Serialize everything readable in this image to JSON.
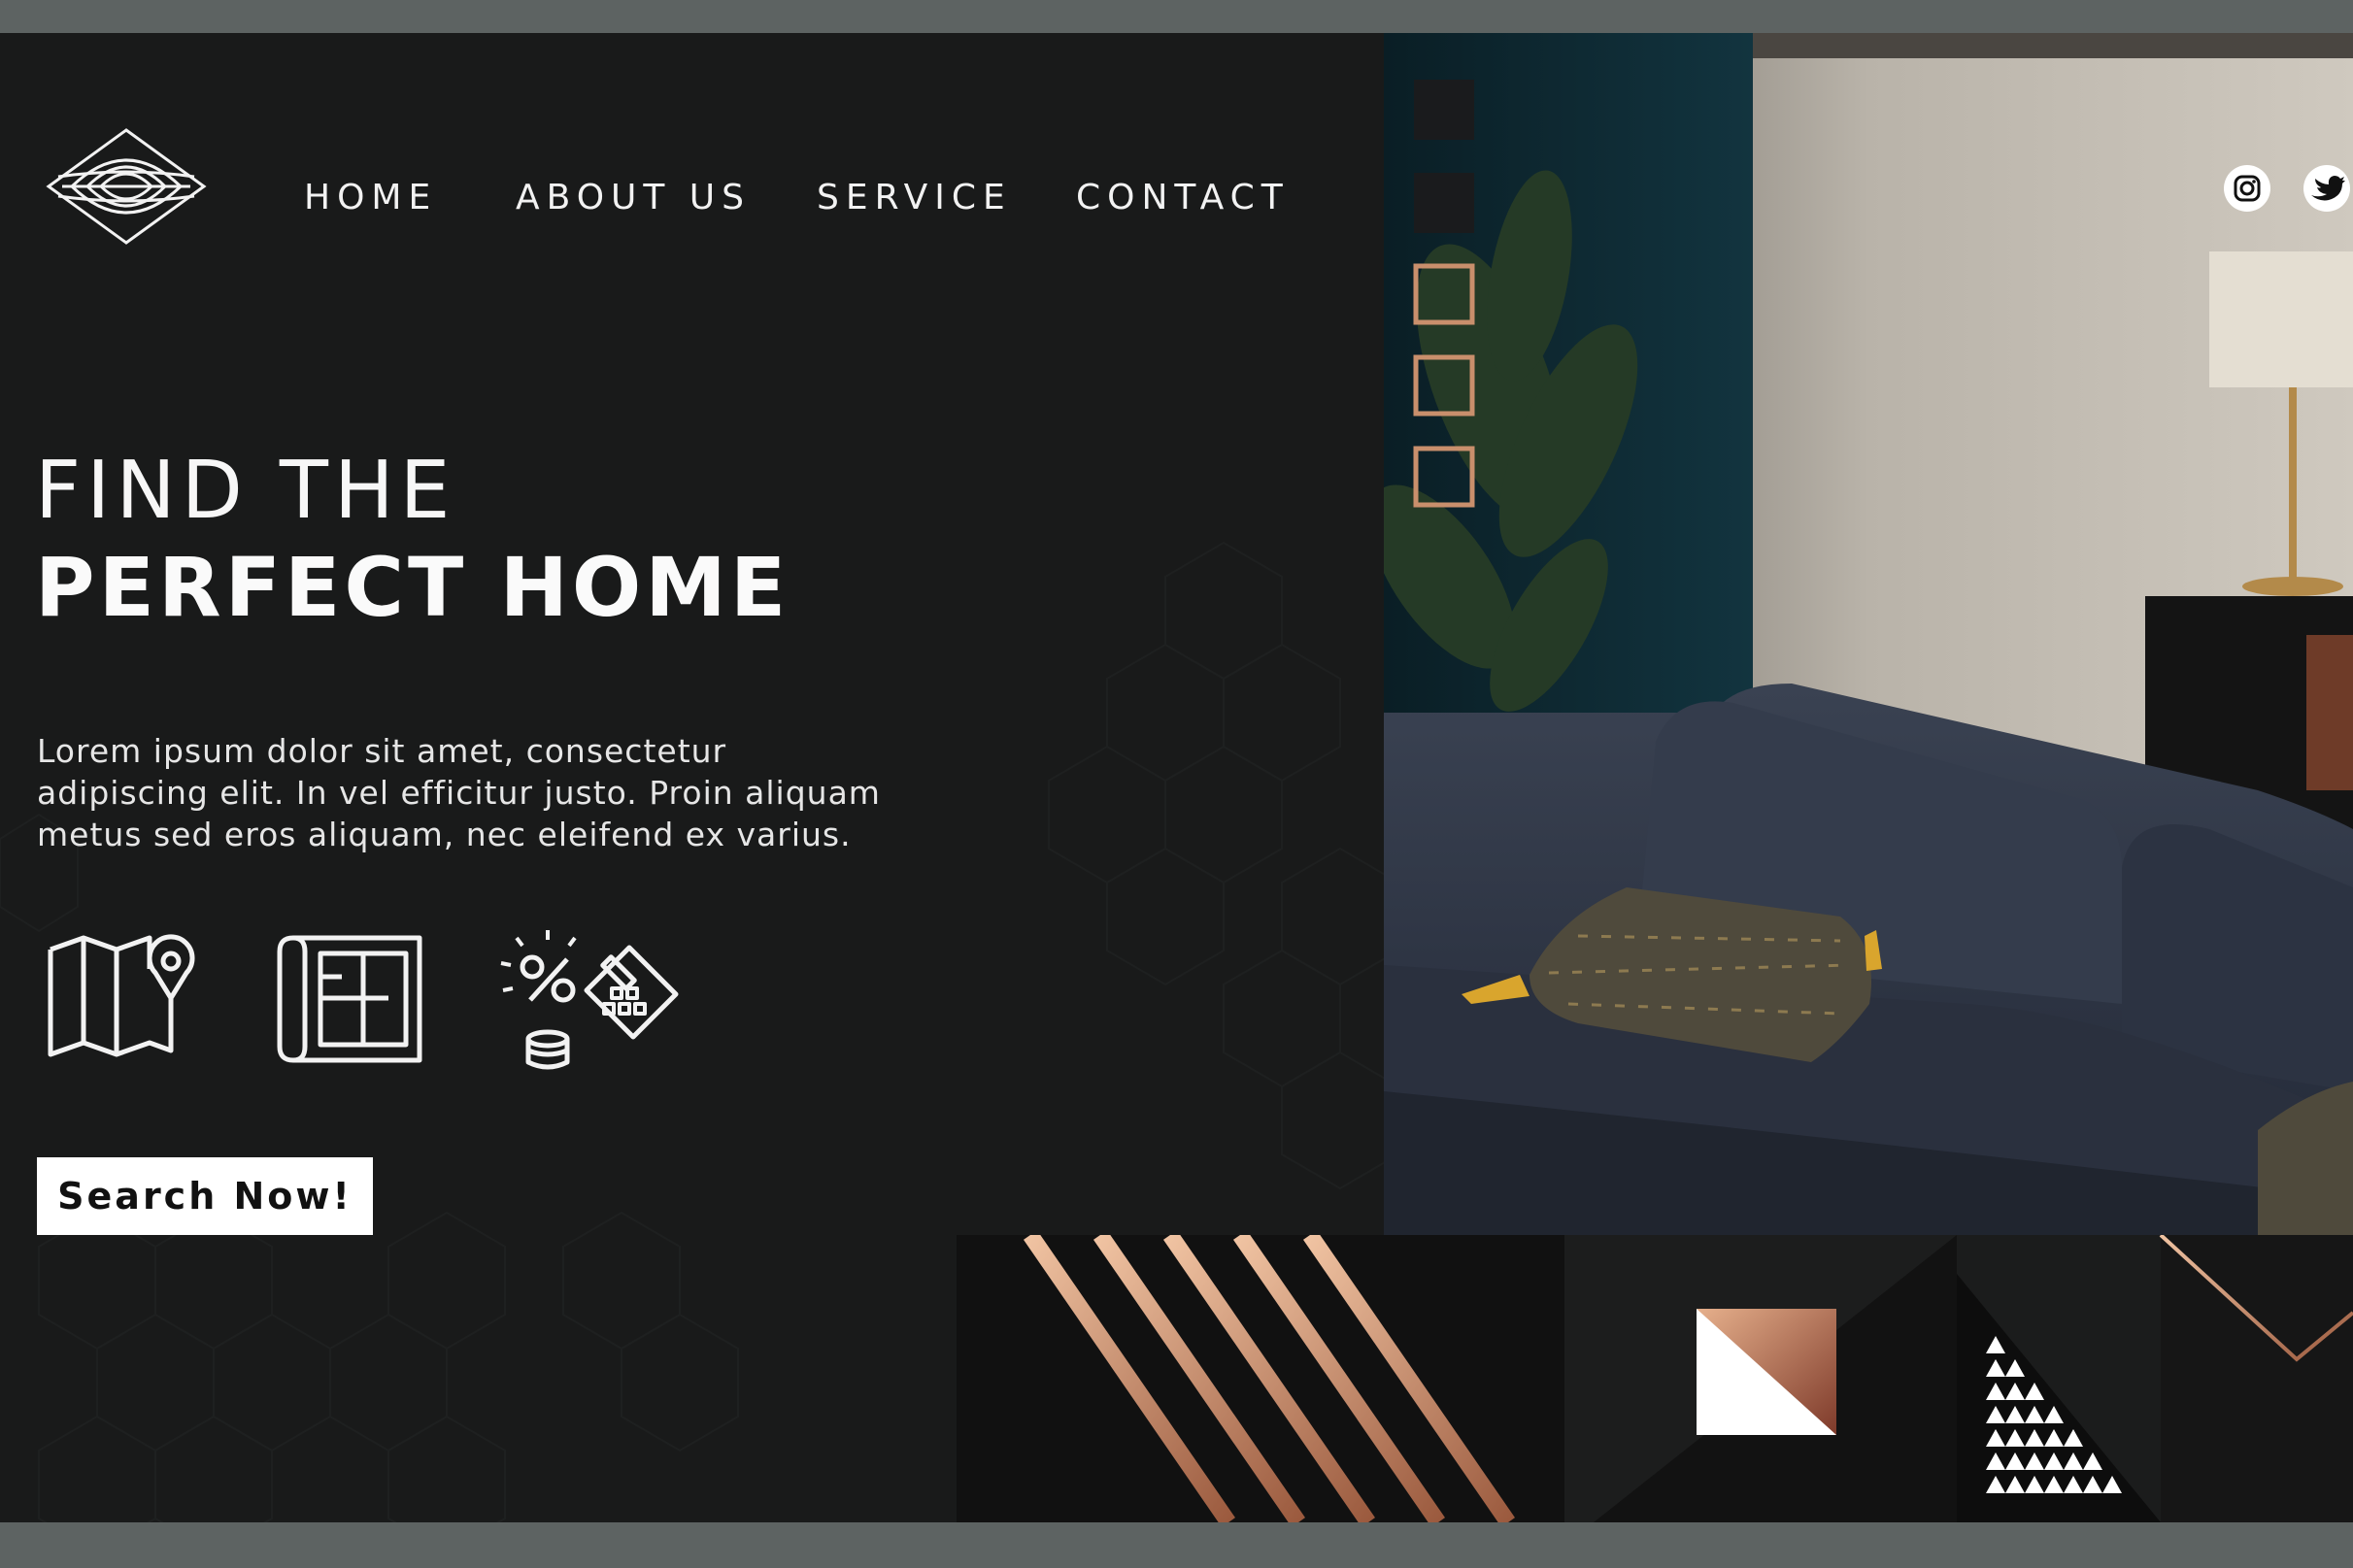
{
  "nav": {
    "items": [
      {
        "label": "HOME"
      },
      {
        "label": "ABOUT US"
      },
      {
        "label": "SERVICE"
      },
      {
        "label": "CONTACT"
      }
    ]
  },
  "hero": {
    "title_line1": "FIND THE",
    "title_line2": "PERFECT HOME",
    "paragraph_lines": [
      "Lorem ipsum dolor sit amet, consectetur",
      "adipiscing elit. In vel efficitur justo. Proin aliquam",
      "metus sed eros aliquam, nec eleifend ex varius."
    ],
    "features": [
      {
        "icon": "map-pin-icon"
      },
      {
        "icon": "blueprint-icon"
      },
      {
        "icon": "calculator-percent-icon"
      }
    ],
    "cta_label": "Search Now!"
  },
  "social": [
    {
      "icon": "instagram-icon"
    },
    {
      "icon": "twitter-icon"
    }
  ],
  "colors": {
    "background": "#191a1a",
    "frame": "#5d6362",
    "copper": "#c98f6c",
    "copper_dark": "#8a4a35",
    "sofa": "#2f3645",
    "wall_teal": "#0f2f3a",
    "text": "#f2f2f2"
  }
}
